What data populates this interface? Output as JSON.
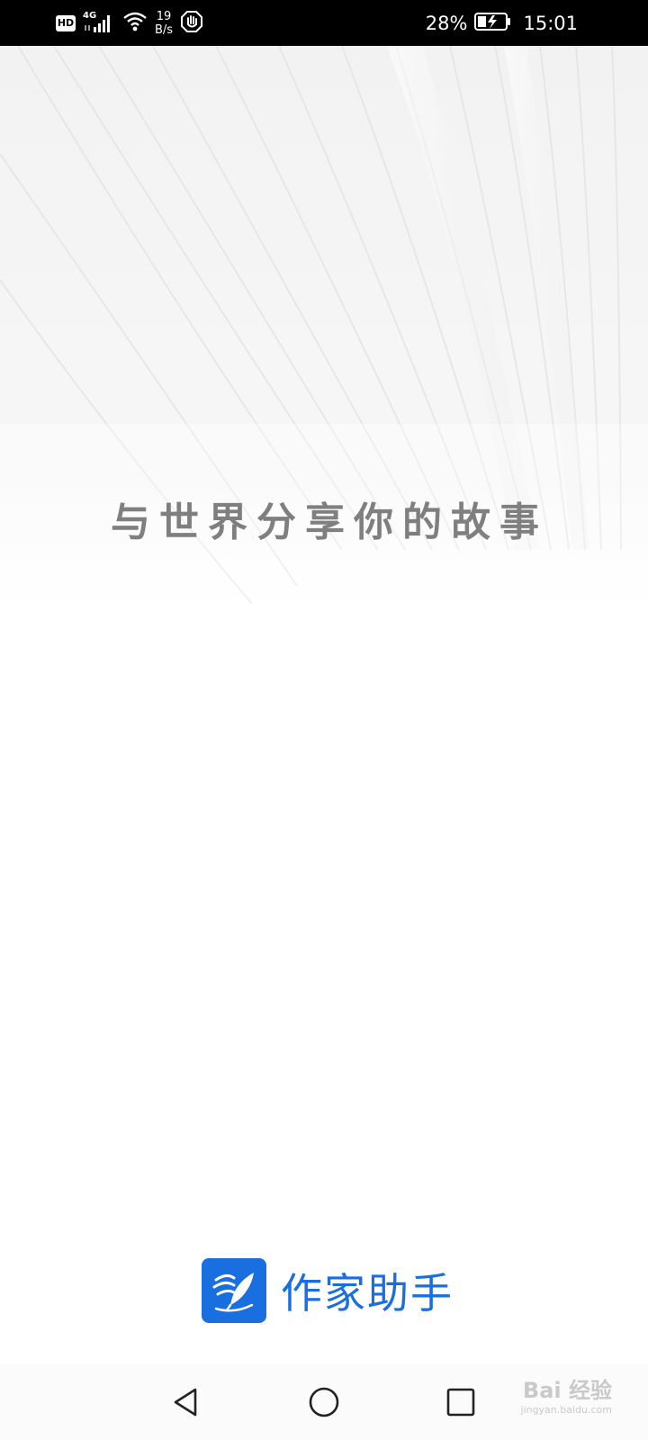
{
  "status_bar": {
    "hd_label": "HD",
    "network_type": "4G",
    "net_speed_value": "19",
    "net_speed_unit": "B/s",
    "battery_percent": "28%",
    "time": "15:01"
  },
  "splash": {
    "slogan": "与世界分享你的故事",
    "app_name": "作家助手",
    "brand_color": "#1a6fe0"
  },
  "watermark": {
    "mark": "Bai 经验",
    "url": "jingyan.baidu.com"
  },
  "icons": {
    "status": [
      "hd-icon",
      "signal-4g-icon",
      "wifi-icon",
      "hand-stop-icon",
      "battery-charging-icon"
    ],
    "nav": [
      "back-triangle-icon",
      "home-circle-icon",
      "recent-square-icon"
    ],
    "logo": "quill-pen-icon"
  }
}
